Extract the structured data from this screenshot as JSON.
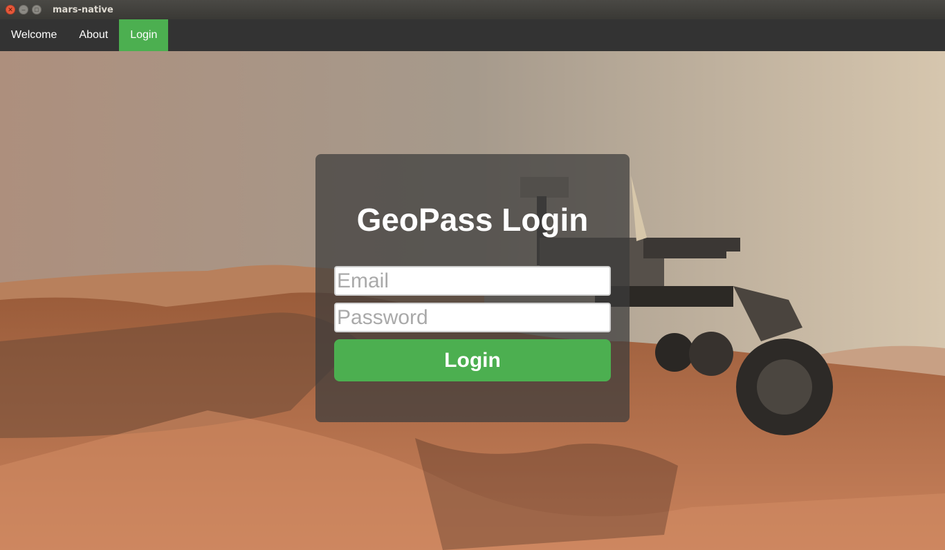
{
  "window": {
    "title": "mars-native"
  },
  "nav": {
    "items": [
      {
        "label": "Welcome"
      },
      {
        "label": "About"
      },
      {
        "label": "Login"
      }
    ],
    "active": "Login"
  },
  "login": {
    "title": "GeoPass Login",
    "email_placeholder": "Email",
    "email_value": "",
    "password_placeholder": "Password",
    "password_value": "",
    "button_label": "Login"
  },
  "colors": {
    "accent": "#4caf50",
    "navbar": "#333333",
    "titlebar": "#3f3e3a",
    "card": "rgba(60,60,60,0.72)"
  },
  "background": {
    "icon": "mars-rover-landscape-icon"
  }
}
